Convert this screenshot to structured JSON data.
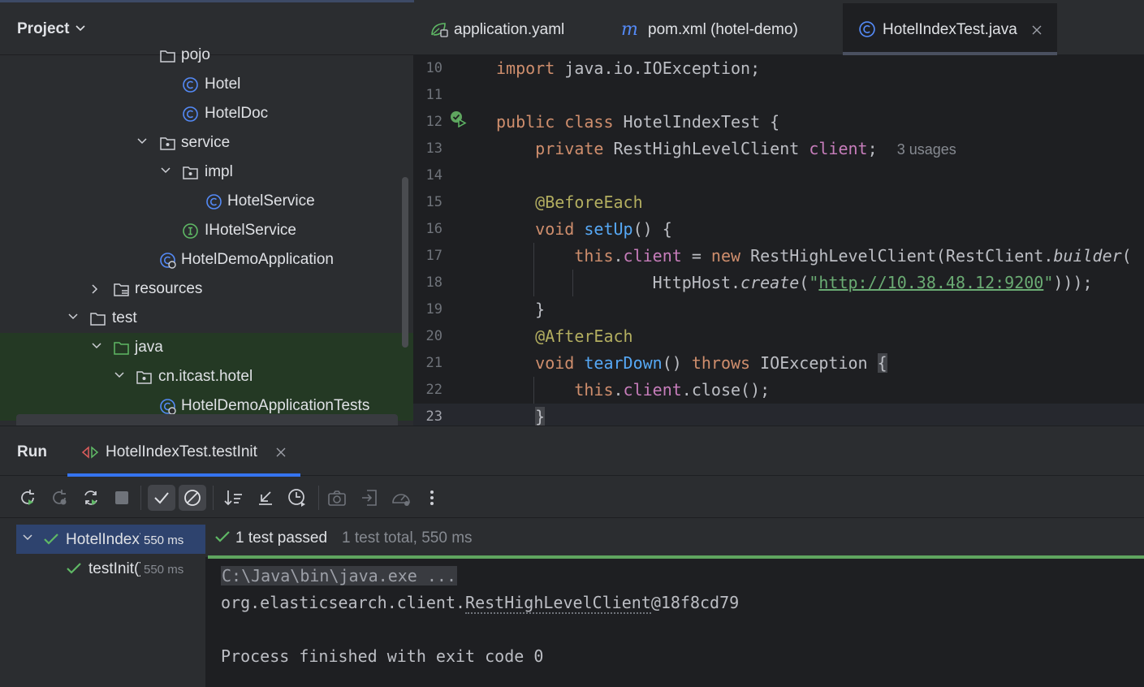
{
  "project": {
    "title": "Project",
    "tree": [
      {
        "label": "pojo",
        "kind": "package",
        "indent": 196,
        "partial": true
      },
      {
        "label": "Hotel",
        "kind": "class"
      },
      {
        "label": "HotelDoc",
        "kind": "class"
      },
      {
        "label": "service",
        "kind": "package",
        "expanded": true
      },
      {
        "label": "impl",
        "kind": "package",
        "expanded": true
      },
      {
        "label": "HotelService",
        "kind": "class"
      },
      {
        "label": "IHotelService",
        "kind": "interface"
      },
      {
        "label": "HotelDemoApplication",
        "kind": "spring-class"
      },
      {
        "label": "resources",
        "kind": "resources-folder",
        "expanded": false
      },
      {
        "label": "test",
        "kind": "folder",
        "expanded": true
      },
      {
        "label": "java",
        "kind": "test-folder",
        "expanded": true
      },
      {
        "label": "cn.itcast.hotel",
        "kind": "package",
        "expanded": true
      },
      {
        "label": "HotelDemoApplicationTests",
        "kind": "spring-class"
      }
    ]
  },
  "editor": {
    "tabs": [
      {
        "label": "application.yaml",
        "icon": "yaml-icon"
      },
      {
        "label": "pom.xml (hotel-demo)",
        "icon": "maven-icon"
      },
      {
        "label": "HotelIndexTest.java",
        "icon": "class-icon",
        "active": true
      }
    ],
    "line_numbers": [
      "10",
      "11",
      "12",
      "13",
      "14",
      "15",
      "16",
      "17",
      "18",
      "19",
      "20",
      "21",
      "22",
      "23"
    ],
    "current_line": "23",
    "usages_hint": "3 usages",
    "url_literal": "http://10.38.48.12:9200"
  },
  "run": {
    "title": "Run",
    "tab_label": "HotelIndexTest.testInit",
    "results": [
      {
        "name": "HotelIndexTest",
        "time": "550 ms",
        "selected": true
      },
      {
        "name": "testInit()",
        "time": "550 ms",
        "selected": false
      }
    ],
    "status_passed": "1 test passed",
    "status_total": "1 test total, 550 ms",
    "console": {
      "cmd": "C:\\Java\\bin\\java.exe ...",
      "out_prefix": "org.elasticsearch.client.",
      "out_class": "RestHighLevelClient",
      "out_suffix": "@18f8cd79",
      "exit": "Process finished with exit code 0"
    }
  },
  "colors": {
    "accent": "#3574f0",
    "pass_green": "#5fa55f",
    "keyword": "#cf8e6d",
    "method": "#56a8f5",
    "field": "#c77dbb",
    "annotation": "#b3ae60",
    "string": "#6aab73"
  }
}
